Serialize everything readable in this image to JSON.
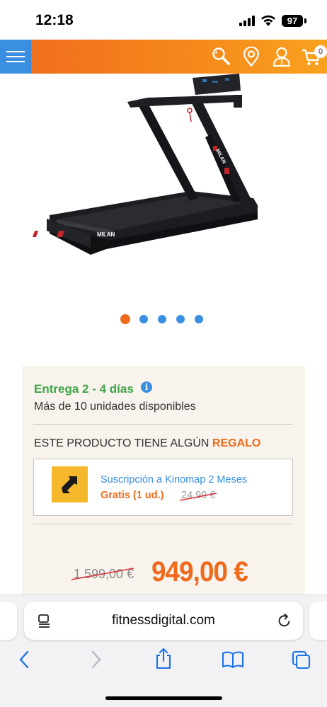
{
  "status_bar": {
    "time": "12:18",
    "battery": "97"
  },
  "header": {
    "menu_icon": "hamburger-icon",
    "icons": [
      "search-icon",
      "location-pin-icon",
      "user-icon",
      "cart-icon"
    ],
    "cart_count": "0",
    "brand_color": "#ef6a1c",
    "menu_color": "#3b8fe0"
  },
  "product": {
    "image": "treadmill-image",
    "brand_label": "MILAN",
    "carousel": {
      "total": 5,
      "active": 1
    }
  },
  "details": {
    "delivery": "Entrega 2 - 4 días",
    "stock": "Más de 10 unidades disponibles",
    "gift_prefix": "ESTE PRODUCTO TIENE ALGÚN ",
    "gift_highlight": "REGALO",
    "gift": {
      "name": "Suscripción a Kinomap 2 Meses",
      "free": "Gratis (1 ud.)",
      "old_price": "24,99 €"
    },
    "old_price": "1.599,00 €",
    "price": "949,00 €"
  },
  "browser": {
    "url": "fitnessdigital.com",
    "toolbar_icons": [
      "back-icon",
      "forward-icon",
      "share-icon",
      "bookmarks-icon",
      "tabs-icon"
    ]
  }
}
